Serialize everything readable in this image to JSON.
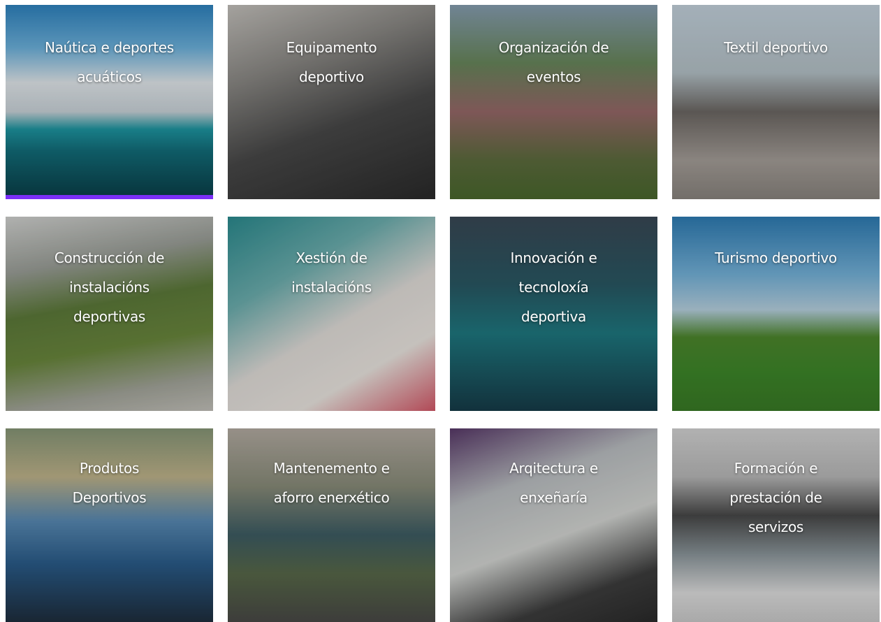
{
  "accent_color": "#7b2ff7",
  "tiles": [
    {
      "label_lines": [
        "Naútica e deportes",
        "acuáticos"
      ]
    },
    {
      "label_lines": [
        "Equipamento",
        "deportivo"
      ]
    },
    {
      "label_lines": [
        "Organización de",
        "eventos"
      ]
    },
    {
      "label_lines": [
        "Textil deportivo"
      ]
    },
    {
      "label_lines": [
        "Construcción de",
        "instalacións",
        "deportivas"
      ]
    },
    {
      "label_lines": [
        "Xestión de",
        "instalacións"
      ]
    },
    {
      "label_lines": [
        "Innovación e",
        "tecnoloxía",
        "deportiva"
      ]
    },
    {
      "label_lines": [
        "Turismo deportivo"
      ]
    },
    {
      "label_lines": [
        "Produtos",
        "Deportivos"
      ]
    },
    {
      "label_lines": [
        "Mantenemento e",
        "aforro enerxético"
      ]
    },
    {
      "label_lines": [
        "Arqitectura e",
        "enxeñaría"
      ]
    },
    {
      "label_lines": [
        "Formación e",
        "prestación de",
        "servizos"
      ]
    }
  ]
}
